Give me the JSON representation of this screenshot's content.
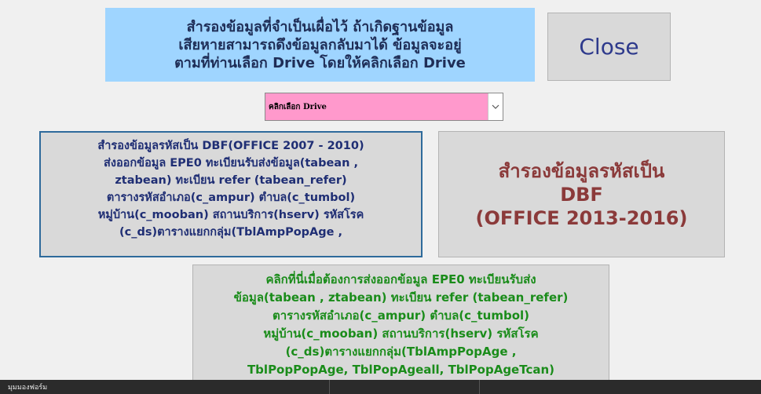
{
  "info": {
    "lines": [
      "สำรองข้อมูลที่จำเป็นเผื่อไว้ ถ้าเกิดฐานข้อมูล",
      "เสียหายสามารถดึงข้อมูลกลับมาได้ ข้อมูลจะอยู่",
      "ตามที่ท่านเลือก Drive โดยให้คลิกเลือก Drive"
    ]
  },
  "close_button": {
    "label": "Close"
  },
  "drive_select": {
    "label": "คลิกเลือก Drive",
    "value": ""
  },
  "backup_old": {
    "lines": [
      "สำรองข้อมูลรหัสเป็น DBF(OFFICE 2007 - 2010)",
      "ส่งออกข้อมูล EPE0 ทะเบียนรับส่งข้อมูล(tabean ,",
      "ztabean) ทะเบียน refer (tabean_refer)",
      "ตารางรหัสอำเภอ(c_ampur) ตำบล(c_tumbol)",
      "หมู่บ้าน(c_mooban) สถานบริการ(hserv) รหัสโรค",
      "(c_ds)ตารางแยกกลุ่ม(TblAmpPopAge ,"
    ]
  },
  "backup_new": {
    "lines": [
      "สำรองข้อมูลรหัสเป็น",
      "DBF",
      "(OFFICE 2013-2016)"
    ]
  },
  "export_button": {
    "lines": [
      "คลิกที่นี่เมื่อต้องการส่งออกข้อมูล EPE0 ทะเบียนรับส่ง",
      "ข้อมูล(tabean , ztabean) ทะเบียน refer (tabean_refer)",
      "ตารางรหัสอำเภอ(c_ampur) ตำบล(c_tumbol)",
      "หมู่บ้าน(c_mooban) สถานบริการ(hserv) รหัสโรค",
      "(c_ds)ตารางแยกกลุ่ม(TblAmpPopAge ,",
      "TblPopPopAge, TblPopAgeall, TblPopAgeTcan)"
    ]
  },
  "statusbar": {
    "text": "มุมมองฟอร์ม"
  },
  "colors": {
    "info_bg": "#9fd5ff",
    "select_bg": "#ff99cc",
    "green_text": "#1a8c1a",
    "red_text": "#8b3a3a",
    "blue_text": "#1f2e74"
  },
  "icons": {
    "dropdown": "chevron-down-icon"
  }
}
